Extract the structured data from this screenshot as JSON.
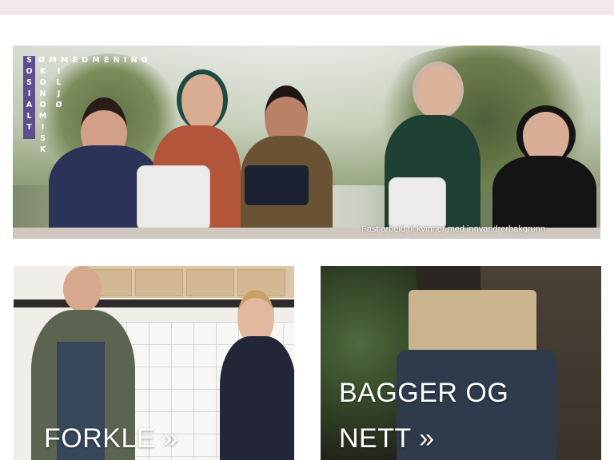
{
  "hero": {
    "logo": {
      "vertical_word": [
        "S",
        "O",
        "S",
        "I",
        "A",
        "L",
        "T"
      ],
      "horizontal_word": "ØMMEDMENING",
      "columns": [
        [
          "K",
          "O",
          "N",
          "O",
          "M",
          "I",
          "S",
          "K"
        ],
        [
          "I",
          "L",
          "J",
          "Ø"
        ]
      ]
    },
    "caption": "Fast arbeid til kvinner med innvandrerbakgrunn"
  },
  "cards": [
    {
      "title": "FORKLE »"
    },
    {
      "title_line1": "BAGGER OG",
      "title_line2": "NETT »"
    }
  ],
  "colors": {
    "top_bar": "#f3e7e8",
    "logo_purple": "#5d4f8f"
  }
}
